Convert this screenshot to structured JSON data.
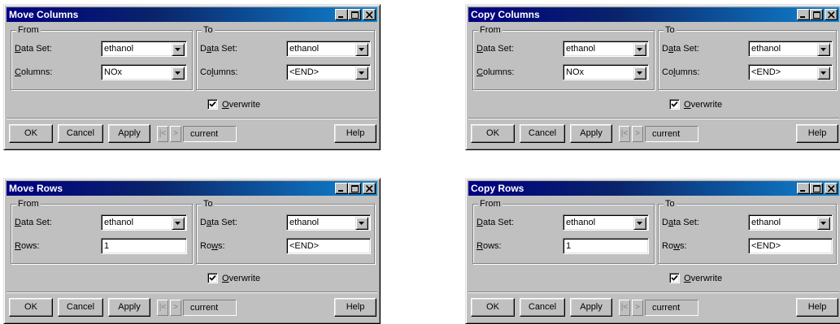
{
  "common": {
    "from_label": "From",
    "to_label": "To",
    "dataset_label_pre": "D",
    "dataset_label_acc": "a",
    "dataset_label_post": "ta Set:",
    "from_dataset_label_pre": "",
    "from_dataset_label_acc": "D",
    "from_dataset_label_post": "ata Set:",
    "dataset_value": "ethanol",
    "overwrite_pre": "",
    "overwrite_acc": "O",
    "overwrite_post": "verwrite",
    "overwrite_checked": true,
    "ok_label": "OK",
    "cancel_label": "Cancel",
    "apply_label": "Apply",
    "prev_glyph": "|<",
    "next_glyph": ">",
    "current_label": "current",
    "help_label": "Help"
  },
  "move_columns": {
    "title": "Move Columns",
    "from_item_pre": "",
    "from_item_acc": "C",
    "from_item_post": "olumns:",
    "from_item_value": "NOx",
    "to_item_pre": "Co",
    "to_item_acc": "l",
    "to_item_post": "umns:",
    "to_item_value": "<END>"
  },
  "copy_columns": {
    "title": "Copy Columns",
    "from_item_pre": "",
    "from_item_acc": "C",
    "from_item_post": "olumns:",
    "from_item_value": "NOx",
    "to_item_pre": "Co",
    "to_item_acc": "l",
    "to_item_post": "umns:",
    "to_item_value": "<END>"
  },
  "move_rows": {
    "title": "Move Rows",
    "from_item_pre": "",
    "from_item_acc": "R",
    "from_item_post": "ows:",
    "from_item_value": "1",
    "to_item_pre": "Ro",
    "to_item_acc": "w",
    "to_item_post": "s:",
    "to_item_value": "<END>"
  },
  "copy_rows": {
    "title": "Copy Rows",
    "from_item_pre": "",
    "from_item_acc": "R",
    "from_item_post": "ows:",
    "from_item_value": "1",
    "to_item_pre": "Ro",
    "to_item_acc": "w",
    "to_item_post": "s:",
    "to_item_value": "<END>"
  }
}
